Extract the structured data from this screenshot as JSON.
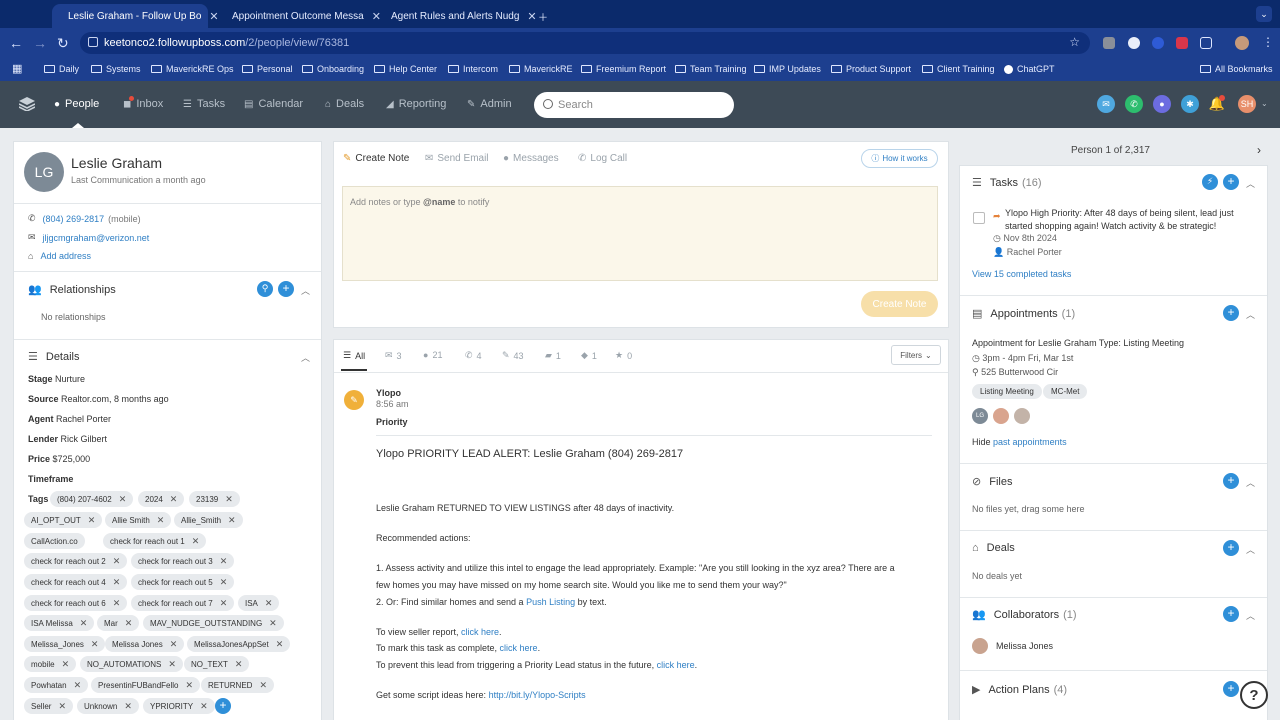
{
  "browser": {
    "tabs": [
      {
        "title": "Leslie Graham - Follow Up Bo",
        "active": true
      },
      {
        "title": "Appointment Outcome Messa",
        "active": false
      },
      {
        "title": "Agent Rules and Alerts Nudg",
        "active": false
      }
    ],
    "url_host": "keetonco2.followupboss.com",
    "url_path": "/2/people/view/76381",
    "bookmarks": [
      "Daily",
      "Systems",
      "MaverickRE Ops",
      "Personal",
      "Onboarding",
      "Help Center",
      "Intercom",
      "MaverickRE",
      "Freemium Report",
      "Team Training",
      "IMP Updates",
      "Product Support",
      "Client Training",
      "ChatGPT"
    ],
    "all_bookmarks": "All Bookmarks"
  },
  "app": {
    "nav": [
      "People",
      "Inbox",
      "Tasks",
      "Calendar",
      "Deals",
      "Reporting",
      "Admin"
    ],
    "search_placeholder": "Search",
    "user_initials": "SH"
  },
  "person": {
    "initials": "LG",
    "name": "Leslie Graham",
    "last_comm": "Last Communication a month ago",
    "phone": "(804) 269-2817",
    "phone_type": "(mobile)",
    "email": "jljgcmgraham@verizon.net",
    "add_address": "Add address"
  },
  "relationships": {
    "title": "Relationships",
    "empty": "No relationships"
  },
  "details": {
    "title": "Details",
    "stage_label": "Stage",
    "stage": "Nurture",
    "source_label": "Source",
    "source": "Realtor.com, 8 months ago",
    "agent_label": "Agent",
    "agent": "Rachel Porter",
    "lender_label": "Lender",
    "lender": "Rick Gilbert",
    "price_label": "Price",
    "price": "$725,000",
    "timeframe_label": "Timeframe",
    "tags_label": "Tags",
    "tags": [
      "(804) 207-4602",
      "2024",
      "23139",
      "AI_OPT_OUT",
      "Allie Smith",
      "Allie_Smith",
      "CallAction.co",
      "check for reach out 1",
      "check for reach out 2",
      "check for reach out 3",
      "check for reach out 4",
      "check for reach out 5",
      "check for reach out 6",
      "check for reach out 7",
      "ISA",
      "ISA Melissa",
      "Mar",
      "MAV_NUDGE_OUTSTANDING",
      "Melissa_Jones",
      "Melissa Jones",
      "MelissaJonesAppSet",
      "mobile",
      "NO_AUTOMATIONS",
      "NO_TEXT",
      "Powhatan",
      "PresentinFUBandFello",
      "RETURNED",
      "Seller",
      "Unknown",
      "YPRIORITY"
    ]
  },
  "composer": {
    "tabs": [
      "Create Note",
      "Send Email",
      "Messages",
      "Log Call"
    ],
    "how_it_works": "How it works",
    "placeholder_pre": "Add notes or type ",
    "placeholder_bold": "@name",
    "placeholder_post": " to notify",
    "button": "Create Note"
  },
  "feed": {
    "tabs": [
      {
        "icon": "all",
        "label": "All"
      },
      {
        "icon": "email",
        "label": "3"
      },
      {
        "icon": "message",
        "label": "21"
      },
      {
        "icon": "phone",
        "label": "4"
      },
      {
        "icon": "pin",
        "label": "43"
      },
      {
        "icon": "chat",
        "label": "1"
      },
      {
        "icon": "drop",
        "label": "1"
      },
      {
        "icon": "star",
        "label": "0"
      }
    ],
    "filters": "Filters",
    "item": {
      "author": "Ylopo",
      "time": "8:56 am",
      "priority": "Priority",
      "headline": "Ylopo PRIORITY LEAD ALERT: Leslie Graham (804) 269-2817",
      "p1": "Leslie Graham RETURNED TO VIEW LISTINGS after 48 days of inactivity.",
      "p2": "Recommended actions:",
      "p3a": "1. Assess activity and utilize this intel to engage the lead appropriately. Example: \"Are you still looking in the xyz area? There are a",
      "p3b": "few homes you may have missed on my home search site. Would you like me to send them your way?\"",
      "p4_pre": "2. Or: Find similar homes and send a ",
      "p4_link": "Push Listing",
      "p4_post": " by text.",
      "l1_pre": "To view seller report, ",
      "l2_pre": "To mark this task as complete, ",
      "l3_pre": "To prevent this lead from triggering a Priority Lead status in the future, ",
      "click_here": "click here",
      "period": ".",
      "script_pre": "Get some script ideas here: ",
      "script_link": "http://bit.ly/Ylopo-Scripts"
    }
  },
  "right": {
    "person_count": "Person 1 of 2,317",
    "tasks": {
      "title": "Tasks",
      "count": "(16)",
      "item_line1": "Ylopo High Priority: After 48 days of being silent, lead just",
      "item_line2": "started shopping again! Watch activity & be strategic!",
      "date": "Nov 8th 2024",
      "assignee": "Rachel Porter",
      "view_completed": "View 15 completed tasks"
    },
    "appointments": {
      "title": "Appointments",
      "count": "(1)",
      "item": "Appointment for Leslie Graham Type: Listing Meeting",
      "time": "3pm - 4pm Fri, Mar 1st",
      "address": "525 Butterwood Cir",
      "pills": [
        "Listing Meeting",
        "MC-Met"
      ],
      "attendee_initials": "LG",
      "hide": "Hide",
      "past": "past appointments"
    },
    "files": {
      "title": "Files",
      "empty": "No files yet, drag some here"
    },
    "deals": {
      "title": "Deals",
      "empty": "No deals yet"
    },
    "collaborators": {
      "title": "Collaborators",
      "count": "(1)",
      "name": "Melissa Jones"
    },
    "action_plans": {
      "title": "Action Plans",
      "count": "(4)"
    }
  }
}
